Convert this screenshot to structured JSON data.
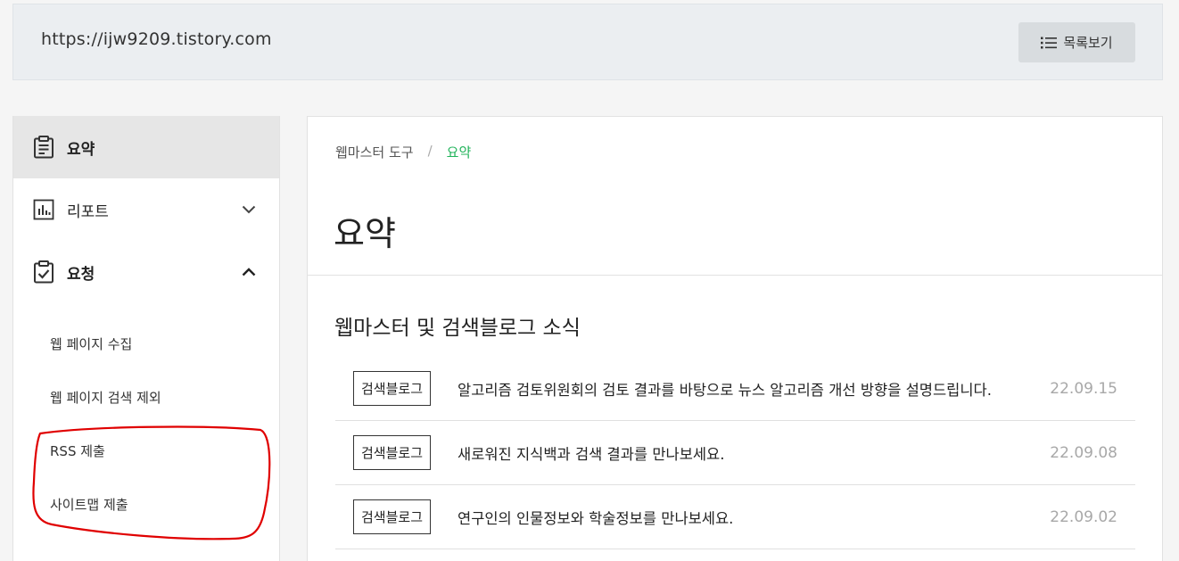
{
  "header": {
    "site_url": "https://ijw9209.tistory.com",
    "list_button_label": "목록보기"
  },
  "sidebar": {
    "items": [
      {
        "label": "요약",
        "icon": "clipboard-icon",
        "active": true
      },
      {
        "label": "리포트",
        "icon": "bar-chart-icon",
        "expanded": false
      },
      {
        "label": "요청",
        "icon": "clipboard-check-icon",
        "expanded": true
      }
    ],
    "sub_items": [
      {
        "label": "웹 페이지 수집"
      },
      {
        "label": "웹 페이지 검색 제외"
      },
      {
        "label": "RSS 제출"
      },
      {
        "label": "사이트맵 제출"
      }
    ]
  },
  "main": {
    "breadcrumb": {
      "parent": "웹마스터 도구",
      "separator": "/",
      "current": "요약"
    },
    "title": "요약",
    "section_title": "웹마스터 및 검색블로그 소식",
    "news": [
      {
        "badge": "검색블로그",
        "title": "알고리즘 검토위원회의 검토 결과를 바탕으로 뉴스 알고리즘 개선 방향을 설명드립니다.",
        "date": "22.09.15"
      },
      {
        "badge": "검색블로그",
        "title": "새로워진 지식백과 검색 결과를 만나보세요.",
        "date": "22.09.08"
      },
      {
        "badge": "검색블로그",
        "title": "연구인의 인물정보와 학술정보를 만나보세요.",
        "date": "22.09.02"
      }
    ]
  },
  "colors": {
    "accent_green": "#21b35a",
    "annotation_red": "#e00000"
  }
}
